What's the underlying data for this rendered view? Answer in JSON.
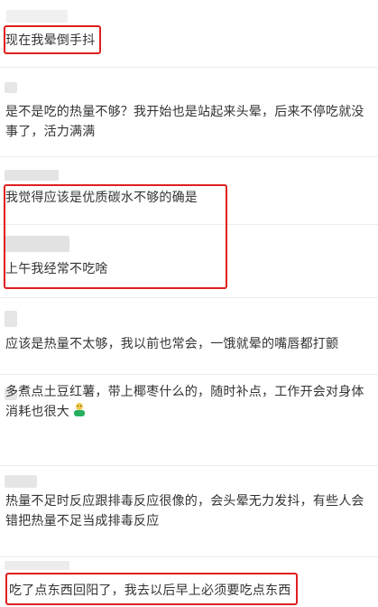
{
  "comments": [
    {
      "text": "现在我晕倒手抖"
    },
    {
      "text": "是不是吃的热量不够？我开始也是站起来头晕，后来不停吃就没事了，活力满满"
    },
    {
      "text": "我觉得应该是优质碳水不够的确是"
    },
    {
      "text": "上午我经常不吃啥"
    },
    {
      "text": "应该是热量不太够，我以前也常会，一饿就晕的嘴唇都打颤"
    },
    {
      "text": "多煮点土豆红薯，带上椰枣什么的，随时补点，工作开会对身体消耗也很大"
    },
    {
      "text": "热量不足时反应跟排毒反应很像的，会头晕无力发抖，有些人会错把热量不足当成排毒反应"
    },
    {
      "text": "吃了点东西回阳了，我去以后早上必须要吃点东西"
    }
  ],
  "emoji": {
    "name": "green-figure-emoji"
  },
  "colors": {
    "highlight": "#e02020",
    "text": "#333333",
    "divider": "#ececec",
    "blur": "#dcdcdc"
  }
}
